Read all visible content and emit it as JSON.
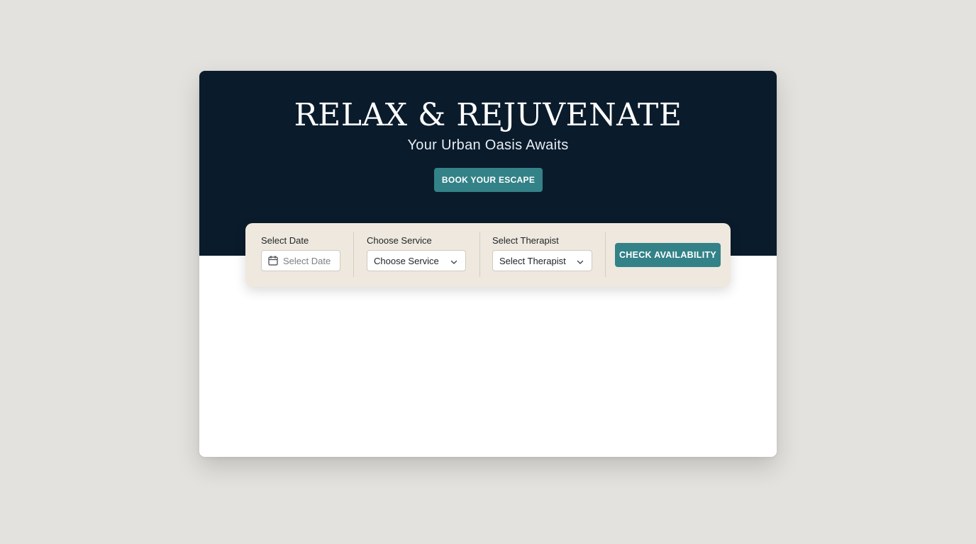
{
  "hero": {
    "title": "RELAX & REJUVENATE",
    "subtitle": "Your Urban Oasis Awaits",
    "cta_label": "BOOK YOUR ESCAPE"
  },
  "booking": {
    "date": {
      "label": "Select Date",
      "placeholder": "Select Date",
      "icon": "calendar-icon"
    },
    "service": {
      "label": "Choose Service",
      "selected": "Choose Service",
      "icon": "chevron-down-icon"
    },
    "therapist": {
      "label": "Select Therapist",
      "selected": "Select Therapist",
      "icon": "chevron-down-icon"
    },
    "submit_label": "CHECK AVAILABILITY"
  },
  "colors": {
    "page_background": "#e4e2de",
    "hero_background": "#0a1b2c",
    "accent": "#338288",
    "booking_bar": "#efe8de"
  }
}
